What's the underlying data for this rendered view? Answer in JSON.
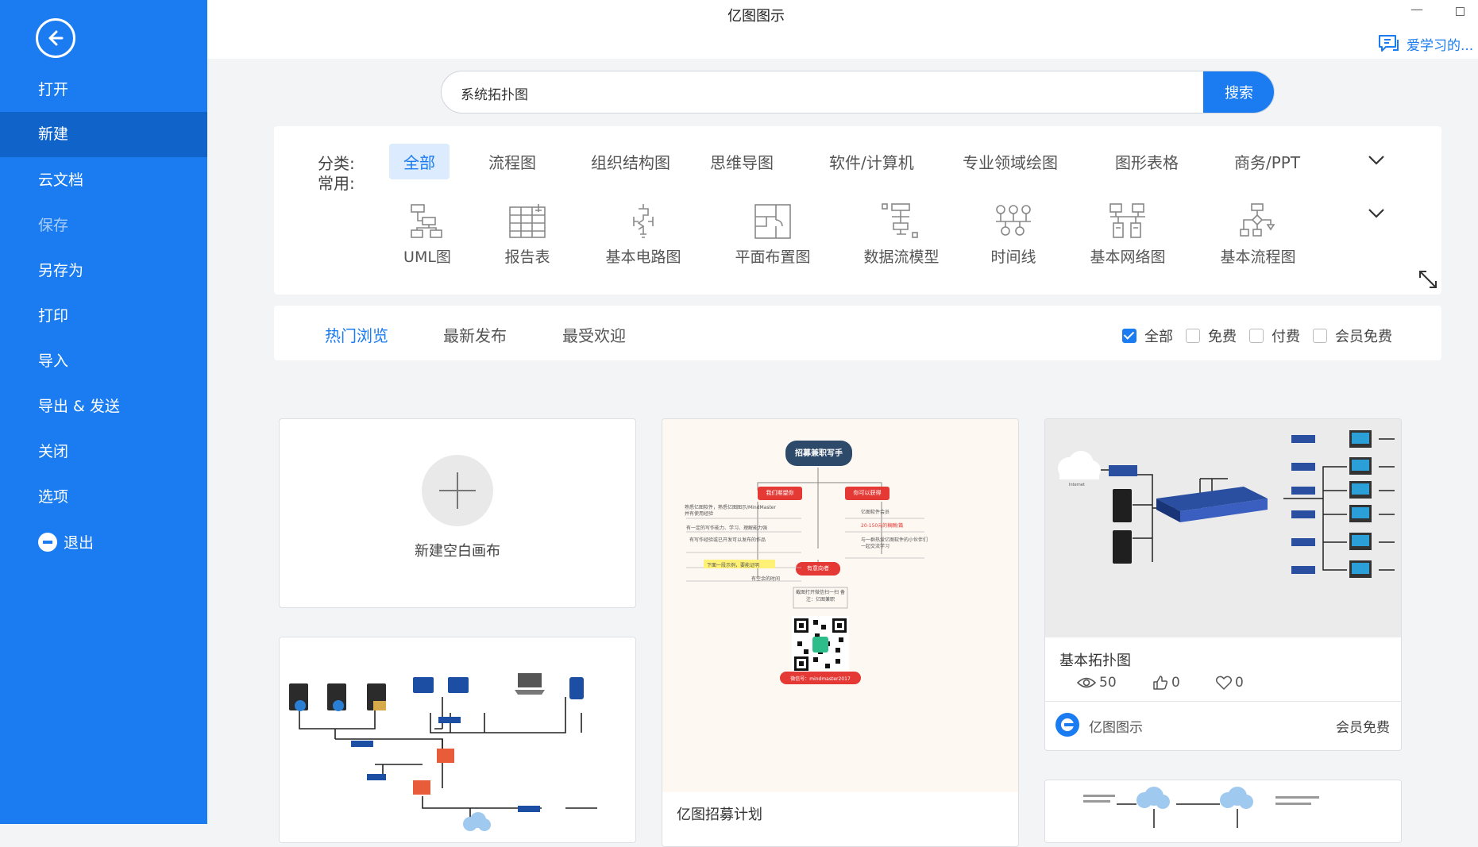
{
  "window": {
    "title": "亿图图示"
  },
  "user": {
    "name": "爱学习的..."
  },
  "sidebar": {
    "items": [
      {
        "label": "打开"
      },
      {
        "label": "新建"
      },
      {
        "label": "云文档"
      },
      {
        "label": "保存"
      },
      {
        "label": "另存为"
      },
      {
        "label": "打印"
      },
      {
        "label": "导入"
      },
      {
        "label": "导出 & 发送"
      },
      {
        "label": "关闭"
      },
      {
        "label": "选项"
      },
      {
        "label": "退出"
      }
    ],
    "active": "新建"
  },
  "search": {
    "value": "系统拓扑图",
    "button": "搜索"
  },
  "categories": {
    "label": "分类:",
    "items": [
      {
        "label": "全部"
      },
      {
        "label": "流程图"
      },
      {
        "label": "组织结构图"
      },
      {
        "label": "思维导图"
      },
      {
        "label": "软件/计算机"
      },
      {
        "label": "专业领域绘图"
      },
      {
        "label": "图形表格"
      },
      {
        "label": "商务/PPT"
      }
    ],
    "active": "全部"
  },
  "common": {
    "label": "常用:",
    "items": [
      {
        "label": "UML图",
        "icon": "uml-icon"
      },
      {
        "label": "报告表",
        "icon": "report-icon"
      },
      {
        "label": "基本电路图",
        "icon": "circuit-icon"
      },
      {
        "label": "平面布置图",
        "icon": "floorplan-icon"
      },
      {
        "label": "数据流模型",
        "icon": "dataflow-icon"
      },
      {
        "label": "时间线",
        "icon": "timeline-icon"
      },
      {
        "label": "基本网络图",
        "icon": "network-icon"
      },
      {
        "label": "基本流程图",
        "icon": "flowchart-icon"
      }
    ]
  },
  "sort_tabs": [
    {
      "label": "热门浏览"
    },
    {
      "label": "最新发布"
    },
    {
      "label": "最受欢迎"
    }
  ],
  "sort_active": "热门浏览",
  "filters": [
    {
      "label": "全部",
      "checked": true
    },
    {
      "label": "免费",
      "checked": false
    },
    {
      "label": "付费",
      "checked": false
    },
    {
      "label": "会员免费",
      "checked": false
    }
  ],
  "cards": {
    "new_blank": {
      "label": "新建空白画布"
    },
    "recruit": {
      "title": "亿图招募计划",
      "preview": {
        "header": "招募兼职写手",
        "left_tag": "我们期望你",
        "right_tag": "你可以获得",
        "left_lines": [
          "熟悉亿图软件，熟悉亿图图示/MindMaster并有使用经验",
          "有一定的写作能力、学习、理解能力强",
          "有写作经验或已开发可以发布的作品",
          "下面一段示例，要能证明",
          "有空余的时间"
        ],
        "right_lines": [
          "亿图软件会员",
          "20-150元的稿酬/篇",
          "与一群热爱亿图软件的小伙伴们一起交流学习"
        ],
        "contact_tag": "有意向者",
        "contact_line": "截图打开微信扫一扫 备注：亿图兼职",
        "footer": "微信号：mindmaster2017"
      }
    },
    "topology": {
      "title": "基本拓扑图",
      "views": "50",
      "likes": "0",
      "favorites": "0",
      "author": "亿图图示",
      "price": "会员免费",
      "preview_label": "Internet"
    }
  },
  "colors": {
    "brand": "#1a7cf0",
    "sidebar_active": "#0f63c9",
    "category_active_bg": "#dcebfd",
    "recruit_accent": "#e53935",
    "recruit_header": "#2e4a6a"
  }
}
